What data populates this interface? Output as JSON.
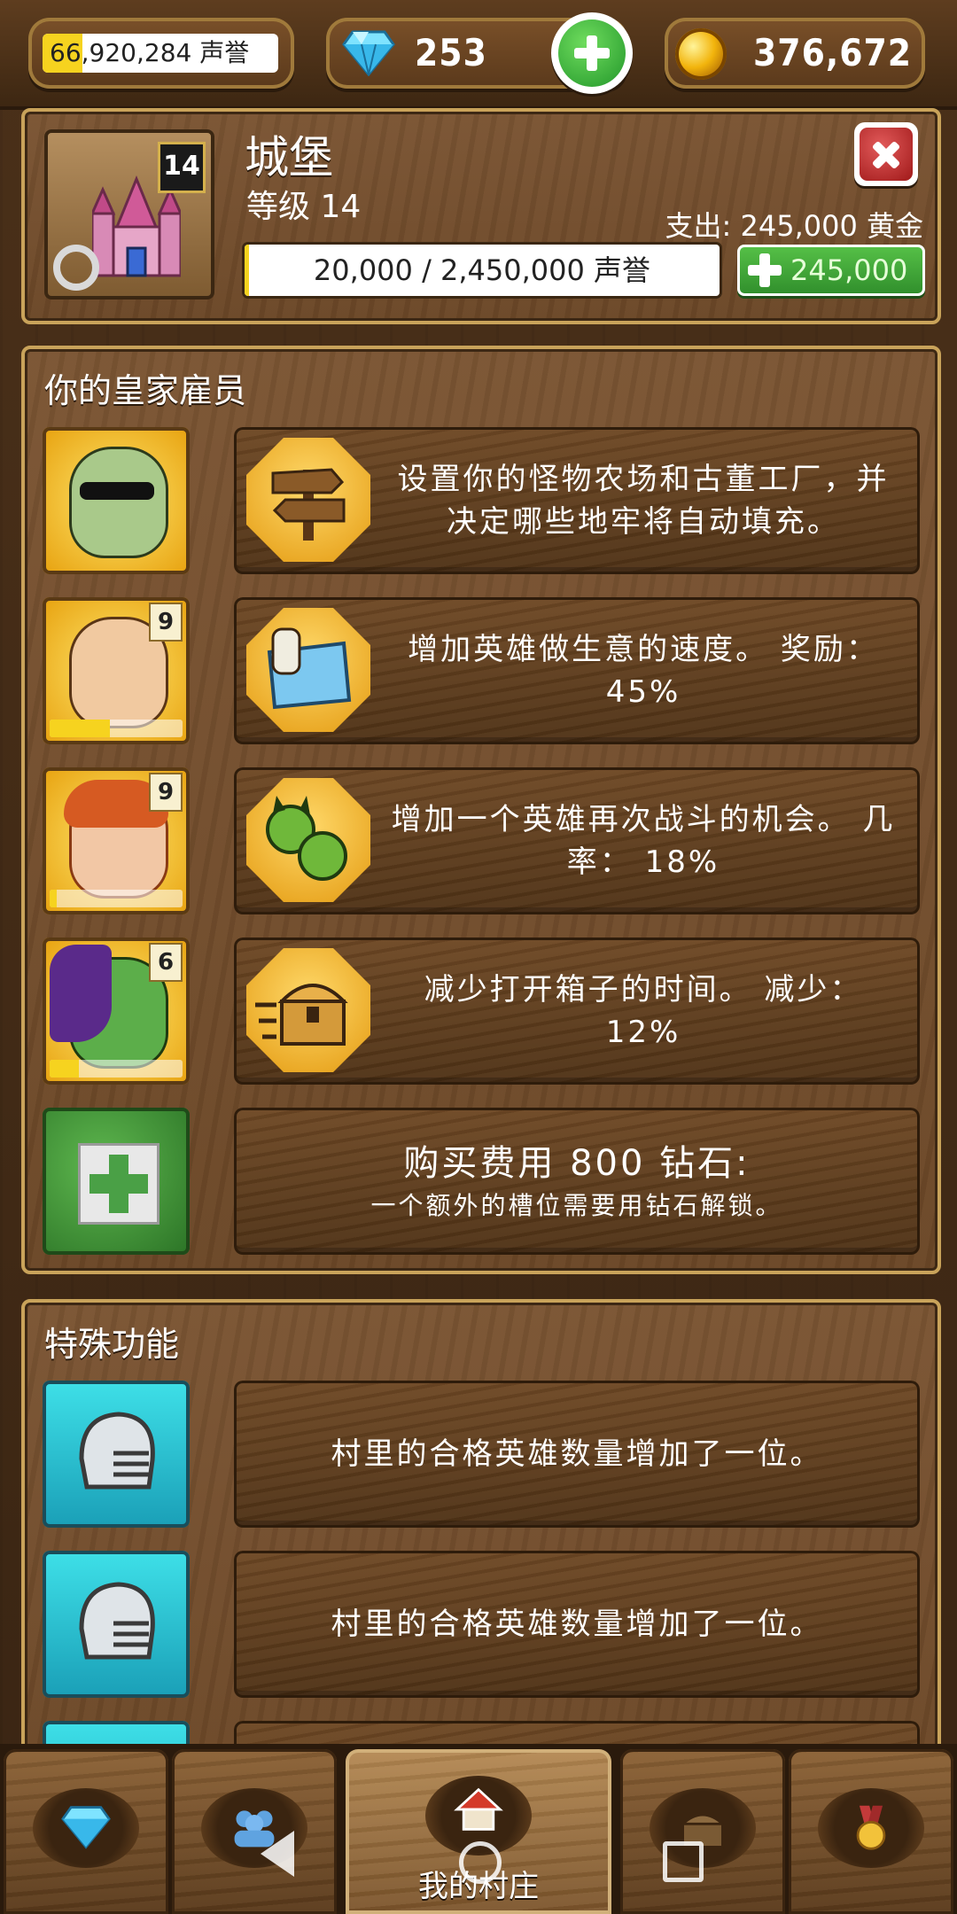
{
  "topbar": {
    "reputation": "66,920,284 声誉",
    "reputation_fill": 0.17,
    "gems": "253",
    "gold": "376,672",
    "gem_icon": "diamond-icon",
    "gold_icon": "gold-coin-icon",
    "add_icon": "plus-icon"
  },
  "building": {
    "name": "城堡",
    "level_label": "等级 14",
    "level_badge": "14",
    "cost": "支出: 245,000 黄金",
    "progress_text": "20,000 / 2,450,000 声誉",
    "progress_fill": 0.008,
    "upgrade_label": "245,000",
    "close_icon": "close-icon",
    "settings_icon": "gear-icon"
  },
  "employees": {
    "title": "你的皇家雇员",
    "rows": [
      {
        "badge": "",
        "skill_fill": 0,
        "icon": "signpost-icon",
        "text": "设置你的怪物农场和古董工厂，并决定哪些地牢将自动填充。"
      },
      {
        "badge": "9",
        "skill_fill": 0.45,
        "icon": "map-scroll-icon",
        "text": "增加英雄做生意的速度。 奖励： 45%"
      },
      {
        "badge": "9",
        "skill_fill": 0.05,
        "icon": "goblin-heads-icon",
        "text": "增加一个英雄再次战斗的机会。 几率： 18%"
      },
      {
        "badge": "6",
        "skill_fill": 0.22,
        "icon": "treasure-chest-icon",
        "text": "减少打开箱子的时间。 减少： 12%"
      }
    ],
    "buy": {
      "title": "购买费用 800 钻石:",
      "subtitle": "一个额外的槽位需要用钻石解锁。",
      "icon": "plus-icon"
    }
  },
  "features": {
    "title": "特殊功能",
    "rows": [
      {
        "icon": "knight-helmet-icon",
        "text": "村里的合格英雄数量增加了一位。"
      },
      {
        "icon": "knight-helmet-icon",
        "text": "村里的合格英雄数量增加了一位。"
      }
    ]
  },
  "nav": {
    "tabs": [
      {
        "name": "gems",
        "icon": "diamond-icon",
        "label": ""
      },
      {
        "name": "heroes",
        "icon": "people-icon",
        "label": ""
      },
      {
        "name": "village",
        "icon": "house-icon",
        "label": "我的村庄"
      },
      {
        "name": "chest",
        "icon": "treasure-chest-icon",
        "label": ""
      },
      {
        "name": "achievements",
        "icon": "medal-icon",
        "label": ""
      }
    ]
  },
  "colors": {
    "accent_gold": "#f6d31f",
    "wood": "#6b4727",
    "button_green": "#2f8d2b",
    "close_red": "#a01919"
  }
}
